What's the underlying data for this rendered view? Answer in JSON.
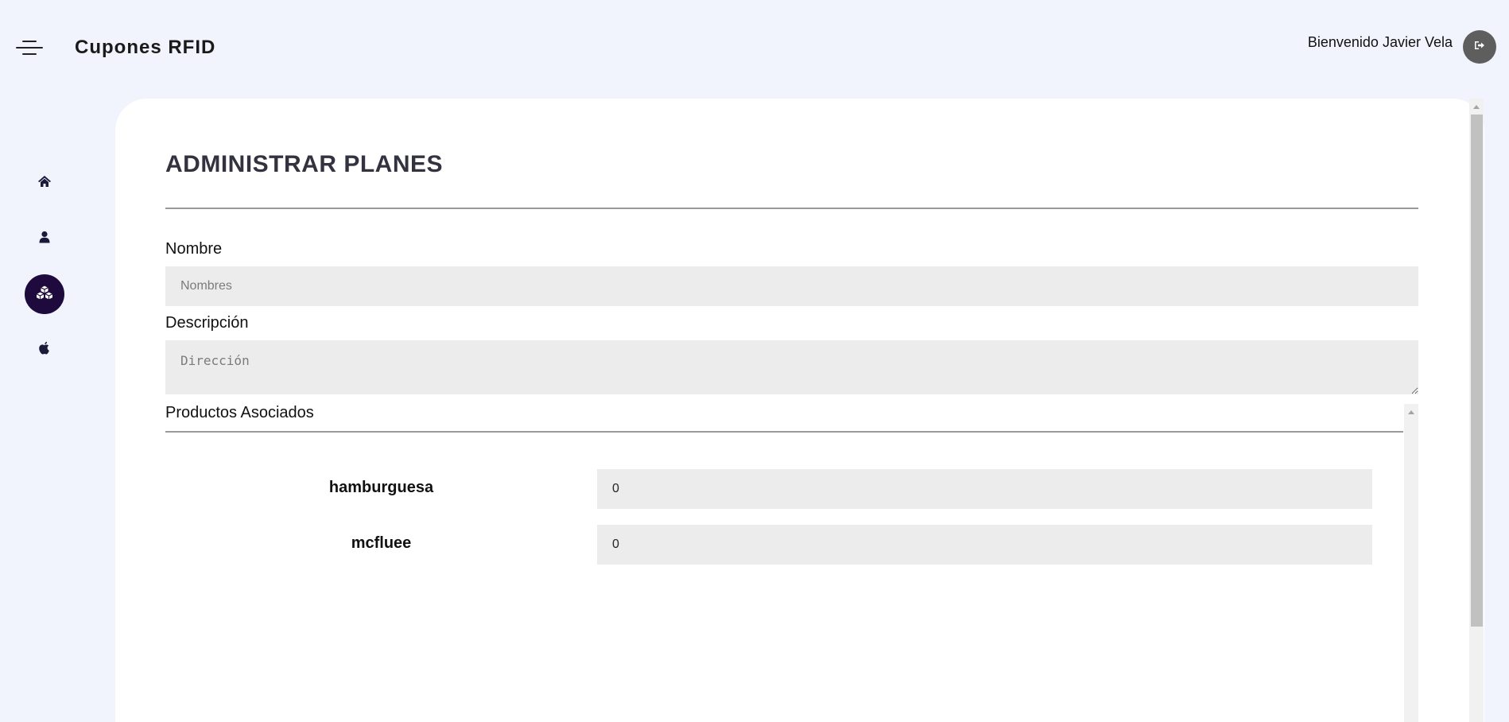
{
  "header": {
    "app_title": "Cupones RFID",
    "welcome": "Bienvenido Javier Vela"
  },
  "icons": {
    "menu": "menu-toggle-icon",
    "logout": "sign-out-icon",
    "home": "home-icon",
    "user": "user-icon",
    "plans": "cubes-icon",
    "apple": "apple-icon"
  },
  "colors": {
    "background": "#f1f4fc",
    "active_nav": "#1e0a3c",
    "title": "#33323f",
    "input_bg": "#ececec"
  },
  "page": {
    "title": "ADMINISTRAR PLANES"
  },
  "form": {
    "name_label": "Nombre",
    "name_placeholder": "Nombres",
    "description_label": "Descripción",
    "description_placeholder": "Dirección",
    "products_label": "Productos Asociados",
    "products": [
      {
        "name": "hamburguesa",
        "quantity": "0"
      },
      {
        "name": "mcfluee",
        "quantity": "0"
      }
    ]
  }
}
